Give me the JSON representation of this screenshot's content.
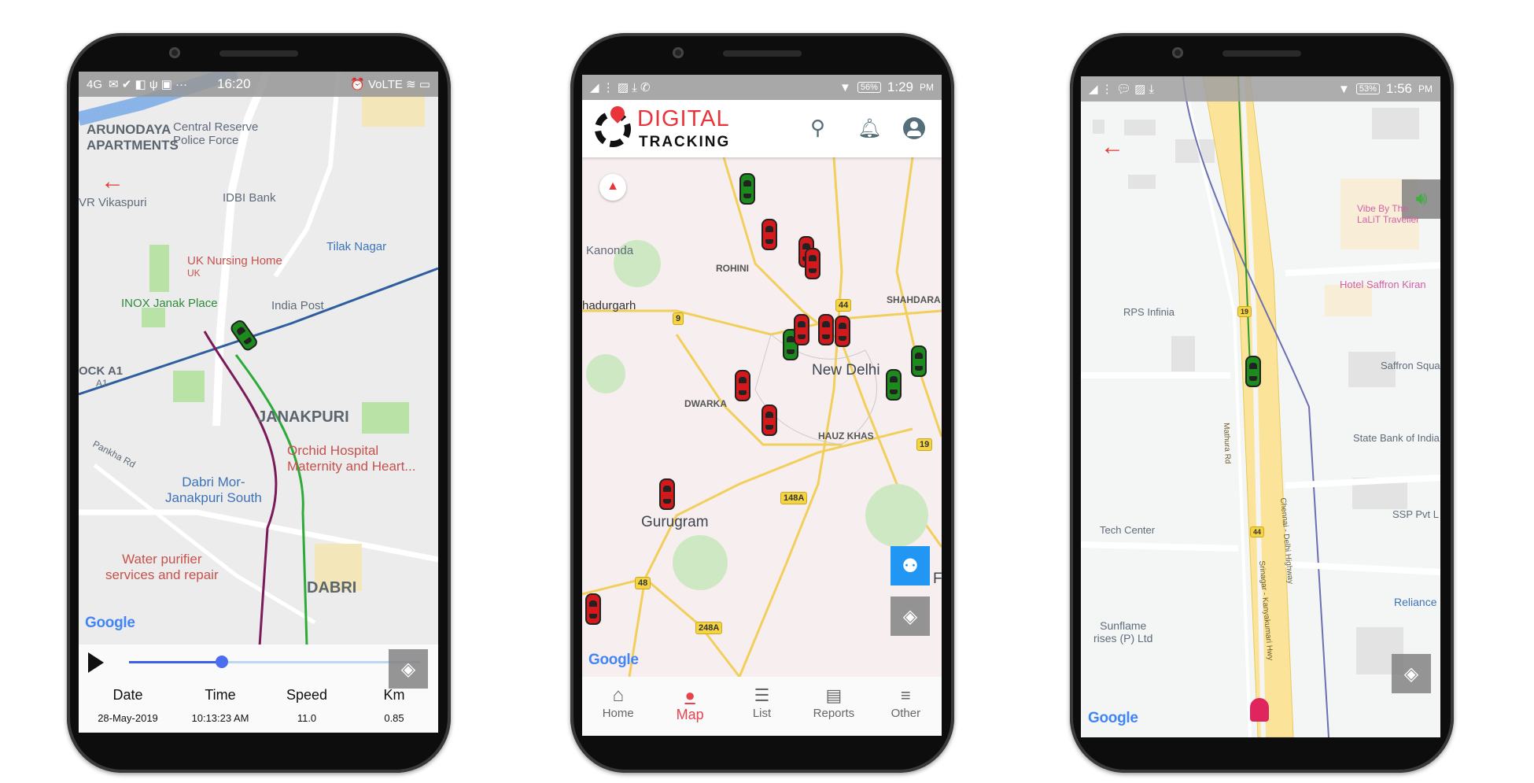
{
  "phone1": {
    "status": {
      "network": "4G",
      "time": "16:20",
      "icons_left": "✉ ✔ ◧ ψ ▣ ···",
      "icons_right": "⏰ VoLTE ≋ ▭"
    },
    "map_labels": {
      "arunodaya": "ARUNODAYA\nAPARTMENTS",
      "crpf": "Central Reserve\nPolice Force",
      "vikaspuri": "VR Vikaspuri",
      "idbi": "IDBI Bank",
      "tilak_nagar": "Tilak Nagar",
      "uk_nursing": "UK Nursing Home",
      "uk": "UK",
      "inox": "INOX Janak Place",
      "india_post": "India Post",
      "block_a1": "OCK A1",
      "a1": "A1",
      "janakpuri": "JANAKPURI",
      "orchid": "Orchid Hospital\nMaternity and Heart...",
      "dabri_mor": "Dabri Mor-\nJanakpuri South",
      "water": "Water purifier\nservices and repair",
      "dabri": "DABRI",
      "pankha": "Pankha Rd"
    },
    "google": "Google",
    "playback": {
      "progress": 0.32,
      "headers": [
        "Date",
        "Time",
        "Speed",
        "Km"
      ],
      "values": [
        "28-May-2019",
        "10:13:23 AM",
        "11.0",
        "0.85"
      ]
    },
    "icons": {
      "back": "arrow-left-icon",
      "play": "play-icon",
      "layers": "layers-icon"
    }
  },
  "phone2": {
    "status": {
      "time": "1:29",
      "ampm": "PM",
      "battery": "56%"
    },
    "logo": {
      "line1": "DIGITAL",
      "line2": "TRACKING"
    },
    "header_icons": [
      "search-icon",
      "bell-icon",
      "account-icon"
    ],
    "map_labels": {
      "kanonda": "Kanonda",
      "rohini": "ROHINI",
      "bahadurgarh": "hadurgarh",
      "shahdara": "SHAHDARA",
      "new_delhi": "New Delhi",
      "dwarka": "DWARKA",
      "hauz_khas": "HAUZ KHAS",
      "gurugram": "Gurugram",
      "f": "F"
    },
    "shields": [
      "44",
      "9",
      "19",
      "148A",
      "48",
      "248A"
    ],
    "google": "Google",
    "vehicles": {
      "green": 4,
      "red": 10
    },
    "nav": [
      {
        "label": "Home",
        "icon": "home-icon",
        "active": false
      },
      {
        "label": "Map",
        "icon": "map-pin-icon",
        "active": true
      },
      {
        "label": "List",
        "icon": "list-icon",
        "active": false
      },
      {
        "label": "Reports",
        "icon": "document-icon",
        "active": false
      },
      {
        "label": "Other",
        "icon": "menu-icon",
        "active": false
      }
    ],
    "colors": {
      "brand_red": "#e8343a",
      "vehicle_green": "#1d8a1d",
      "vehicle_red": "#d4191d",
      "fab_blue": "#2196f3"
    }
  },
  "phone3": {
    "status": {
      "time": "1:56",
      "ampm": "PM",
      "battery": "53%"
    },
    "map_labels": {
      "vibe": "Vibe By The\nLaLiT Traveller",
      "saffron_kiran": "Hotel Saffron Kiran",
      "rps": "RPS Infinia",
      "saffron_squa": "Saffron Squa",
      "sbi": "State Bank of India",
      "ssp": "SSP Pvt L",
      "tech": "Tech Center",
      "reliance": "Reliance",
      "sunflame": "Sunflame\nrises (P) Ltd",
      "mathura": "Mathura Rd",
      "chennai": "Chennai - Delhi Highway",
      "srinagar": "Srinagar - Kanyakumari Hwy"
    },
    "shields": [
      "19",
      "44"
    ],
    "google": "Google",
    "icons": {
      "back": "arrow-left-icon",
      "sound": "volume-icon",
      "layers": "layers-icon"
    }
  }
}
